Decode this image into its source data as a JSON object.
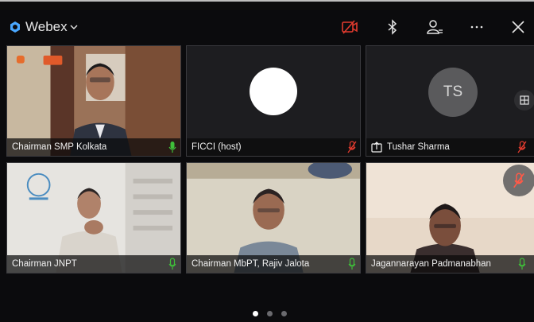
{
  "app": {
    "brand": "Webex"
  },
  "toolbar": {
    "video_icon": "video-off-icon",
    "bluetooth_icon": "bluetooth-icon",
    "participants_icon": "participants-icon",
    "more_icon": "more-icon",
    "close_icon": "close-icon"
  },
  "colors": {
    "muted_red": "#e23b2e",
    "unmuted_green": "#3fbf3a",
    "avatar_grey": "#5a5a5c"
  },
  "participants": [
    {
      "name": "Chairman SMP Kolkata",
      "mic": "unmuted"
    },
    {
      "name": "FICCI (host)",
      "mic": "muted"
    },
    {
      "name": "Tushar Sharma",
      "initials": "TS",
      "mic": "muted",
      "sharing": true
    },
    {
      "name": "Chairman JNPT",
      "mic": "unmuted"
    },
    {
      "name": "Chairman MbPT, Rajiv Jalota",
      "mic": "unmuted"
    },
    {
      "name": "Jagannarayan Padmanabhan",
      "mic": "unmuted"
    }
  ],
  "pagination": {
    "pages": 3,
    "current": 1
  }
}
